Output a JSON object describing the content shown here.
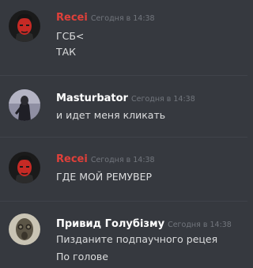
{
  "colors": {
    "background": "#36393f",
    "author_red": "#e0403a",
    "author_white": "#ffffff",
    "timestamp": "#72767d",
    "message_text": "#dcddde"
  },
  "messages": [
    {
      "author": "Recei",
      "author_color": "#e0403a",
      "timestamp": "Сегодня в 14:38",
      "avatar_icon": "red-face-avatar-icon",
      "lines": [
        "ГСБ<",
        "ТАК"
      ]
    },
    {
      "author": "Masturbator",
      "author_color": "#ffffff",
      "timestamp": "Сегодня в 14:38",
      "avatar_icon": "dark-figure-avatar-icon",
      "lines": [
        "и идет меня кликать"
      ]
    },
    {
      "author": "Recei",
      "author_color": "#e0403a",
      "timestamp": "Сегодня в 14:38",
      "avatar_icon": "red-face-avatar-icon",
      "lines": [
        "ГДЕ МОЙ РЕМУВЕР"
      ]
    },
    {
      "author": "Привид Голубізму",
      "author_color": "#ffffff",
      "timestamp": "Сегодня в 14:38",
      "avatar_icon": "gas-mask-avatar-icon",
      "lines": [
        "Пизданите подпаучного рецея",
        "По голове"
      ]
    }
  ]
}
